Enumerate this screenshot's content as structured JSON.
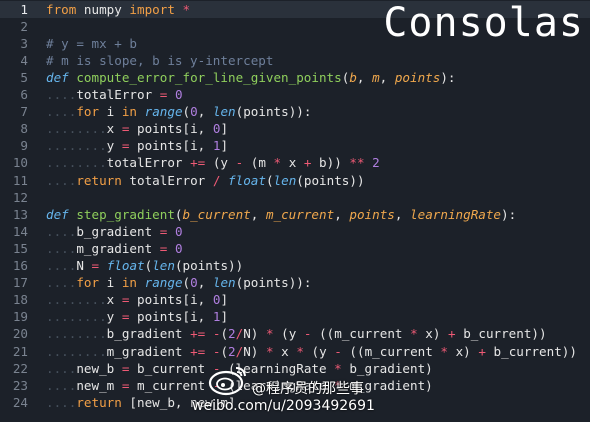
{
  "banner": {
    "font_name": "Consolas"
  },
  "editor": {
    "current_line": 1,
    "lines": [
      {
        "number": "1",
        "tokens": [
          {
            "t": "from",
            "c": "kw"
          },
          {
            "t": " numpy ",
            "c": "plain"
          },
          {
            "t": "import",
            "c": "kw"
          },
          {
            "t": " ",
            "c": "plain"
          },
          {
            "t": "*",
            "c": "op"
          }
        ]
      },
      {
        "number": "2",
        "tokens": []
      },
      {
        "number": "3",
        "tokens": [
          {
            "t": "# y = mx + b",
            "c": "cm"
          }
        ]
      },
      {
        "number": "4",
        "tokens": [
          {
            "t": "# m is slope, b is y-intercept",
            "c": "cm"
          }
        ]
      },
      {
        "number": "5",
        "tokens": [
          {
            "t": "def",
            "c": "def"
          },
          {
            "t": " ",
            "c": "plain"
          },
          {
            "t": "compute_error_for_line_given_points",
            "c": "fn"
          },
          {
            "t": "(",
            "c": "plain"
          },
          {
            "t": "b",
            "c": "param"
          },
          {
            "t": ", ",
            "c": "plain"
          },
          {
            "t": "m",
            "c": "param"
          },
          {
            "t": ", ",
            "c": "plain"
          },
          {
            "t": "points",
            "c": "param"
          },
          {
            "t": "):",
            "c": "plain"
          }
        ]
      },
      {
        "number": "6",
        "tokens": [
          {
            "t": "....",
            "c": "guide"
          },
          {
            "t": "totalError ",
            "c": "plain"
          },
          {
            "t": "=",
            "c": "op"
          },
          {
            "t": " ",
            "c": "plain"
          },
          {
            "t": "0",
            "c": "num"
          }
        ]
      },
      {
        "number": "7",
        "tokens": [
          {
            "t": "....",
            "c": "guide"
          },
          {
            "t": "for",
            "c": "kw"
          },
          {
            "t": " i ",
            "c": "plain"
          },
          {
            "t": "in",
            "c": "kw"
          },
          {
            "t": " ",
            "c": "plain"
          },
          {
            "t": "range",
            "c": "builtin"
          },
          {
            "t": "(",
            "c": "plain"
          },
          {
            "t": "0",
            "c": "num"
          },
          {
            "t": ", ",
            "c": "plain"
          },
          {
            "t": "len",
            "c": "builtin"
          },
          {
            "t": "(points)):",
            "c": "plain"
          }
        ]
      },
      {
        "number": "8",
        "tokens": [
          {
            "t": "........",
            "c": "guide"
          },
          {
            "t": "x ",
            "c": "plain"
          },
          {
            "t": "=",
            "c": "op"
          },
          {
            "t": " points[i, ",
            "c": "plain"
          },
          {
            "t": "0",
            "c": "num"
          },
          {
            "t": "]",
            "c": "plain"
          }
        ]
      },
      {
        "number": "9",
        "tokens": [
          {
            "t": "........",
            "c": "guide"
          },
          {
            "t": "y ",
            "c": "plain"
          },
          {
            "t": "=",
            "c": "op"
          },
          {
            "t": " points[i, ",
            "c": "plain"
          },
          {
            "t": "1",
            "c": "num"
          },
          {
            "t": "]",
            "c": "plain"
          }
        ]
      },
      {
        "number": "10",
        "tokens": [
          {
            "t": "........",
            "c": "guide"
          },
          {
            "t": "totalError ",
            "c": "plain"
          },
          {
            "t": "+=",
            "c": "op"
          },
          {
            "t": " (y ",
            "c": "plain"
          },
          {
            "t": "-",
            "c": "op"
          },
          {
            "t": " (m ",
            "c": "plain"
          },
          {
            "t": "*",
            "c": "op"
          },
          {
            "t": " x ",
            "c": "plain"
          },
          {
            "t": "+",
            "c": "op"
          },
          {
            "t": " b)) ",
            "c": "plain"
          },
          {
            "t": "**",
            "c": "op"
          },
          {
            "t": " ",
            "c": "plain"
          },
          {
            "t": "2",
            "c": "num"
          }
        ]
      },
      {
        "number": "11",
        "tokens": [
          {
            "t": "....",
            "c": "guide"
          },
          {
            "t": "return",
            "c": "kw"
          },
          {
            "t": " totalError ",
            "c": "plain"
          },
          {
            "t": "/",
            "c": "op"
          },
          {
            "t": " ",
            "c": "plain"
          },
          {
            "t": "float",
            "c": "builtin"
          },
          {
            "t": "(",
            "c": "plain"
          },
          {
            "t": "len",
            "c": "builtin"
          },
          {
            "t": "(points))",
            "c": "plain"
          }
        ]
      },
      {
        "number": "12",
        "tokens": []
      },
      {
        "number": "13",
        "tokens": [
          {
            "t": "def",
            "c": "def"
          },
          {
            "t": " ",
            "c": "plain"
          },
          {
            "t": "step_gradient",
            "c": "fn"
          },
          {
            "t": "(",
            "c": "plain"
          },
          {
            "t": "b_current",
            "c": "param"
          },
          {
            "t": ", ",
            "c": "plain"
          },
          {
            "t": "m_current",
            "c": "param"
          },
          {
            "t": ", ",
            "c": "plain"
          },
          {
            "t": "points",
            "c": "param"
          },
          {
            "t": ", ",
            "c": "plain"
          },
          {
            "t": "learningRate",
            "c": "param"
          },
          {
            "t": "):",
            "c": "plain"
          }
        ]
      },
      {
        "number": "14",
        "tokens": [
          {
            "t": "....",
            "c": "guide"
          },
          {
            "t": "b_gradient ",
            "c": "plain"
          },
          {
            "t": "=",
            "c": "op"
          },
          {
            "t": " ",
            "c": "plain"
          },
          {
            "t": "0",
            "c": "num"
          }
        ]
      },
      {
        "number": "15",
        "tokens": [
          {
            "t": "....",
            "c": "guide"
          },
          {
            "t": "m_gradient ",
            "c": "plain"
          },
          {
            "t": "=",
            "c": "op"
          },
          {
            "t": " ",
            "c": "plain"
          },
          {
            "t": "0",
            "c": "num"
          }
        ]
      },
      {
        "number": "16",
        "tokens": [
          {
            "t": "....",
            "c": "guide"
          },
          {
            "t": "N ",
            "c": "plain"
          },
          {
            "t": "=",
            "c": "op"
          },
          {
            "t": " ",
            "c": "plain"
          },
          {
            "t": "float",
            "c": "builtin"
          },
          {
            "t": "(",
            "c": "plain"
          },
          {
            "t": "len",
            "c": "builtin"
          },
          {
            "t": "(points))",
            "c": "plain"
          }
        ]
      },
      {
        "number": "17",
        "tokens": [
          {
            "t": "....",
            "c": "guide"
          },
          {
            "t": "for",
            "c": "kw"
          },
          {
            "t": " i ",
            "c": "plain"
          },
          {
            "t": "in",
            "c": "kw"
          },
          {
            "t": " ",
            "c": "plain"
          },
          {
            "t": "range",
            "c": "builtin"
          },
          {
            "t": "(",
            "c": "plain"
          },
          {
            "t": "0",
            "c": "num"
          },
          {
            "t": ", ",
            "c": "plain"
          },
          {
            "t": "len",
            "c": "builtin"
          },
          {
            "t": "(points)):",
            "c": "plain"
          }
        ]
      },
      {
        "number": "18",
        "tokens": [
          {
            "t": "........",
            "c": "guide"
          },
          {
            "t": "x ",
            "c": "plain"
          },
          {
            "t": "=",
            "c": "op"
          },
          {
            "t": " points[i, ",
            "c": "plain"
          },
          {
            "t": "0",
            "c": "num"
          },
          {
            "t": "]",
            "c": "plain"
          }
        ]
      },
      {
        "number": "19",
        "tokens": [
          {
            "t": "........",
            "c": "guide"
          },
          {
            "t": "y ",
            "c": "plain"
          },
          {
            "t": "=",
            "c": "op"
          },
          {
            "t": " points[i, ",
            "c": "plain"
          },
          {
            "t": "1",
            "c": "num"
          },
          {
            "t": "]",
            "c": "plain"
          }
        ]
      },
      {
        "number": "20",
        "tokens": [
          {
            "t": "........",
            "c": "guide"
          },
          {
            "t": "b_gradient ",
            "c": "plain"
          },
          {
            "t": "+=",
            "c": "op"
          },
          {
            "t": " ",
            "c": "plain"
          },
          {
            "t": "-",
            "c": "op"
          },
          {
            "t": "(",
            "c": "plain"
          },
          {
            "t": "2",
            "c": "num"
          },
          {
            "t": "/",
            "c": "op"
          },
          {
            "t": "N) ",
            "c": "plain"
          },
          {
            "t": "*",
            "c": "op"
          },
          {
            "t": " (y ",
            "c": "plain"
          },
          {
            "t": "-",
            "c": "op"
          },
          {
            "t": " ((m_current ",
            "c": "plain"
          },
          {
            "t": "*",
            "c": "op"
          },
          {
            "t": " x) ",
            "c": "plain"
          },
          {
            "t": "+",
            "c": "op"
          },
          {
            "t": " b_current))",
            "c": "plain"
          }
        ]
      },
      {
        "number": "21",
        "tokens": [
          {
            "t": "........",
            "c": "guide"
          },
          {
            "t": "m_gradient ",
            "c": "plain"
          },
          {
            "t": "+=",
            "c": "op"
          },
          {
            "t": " ",
            "c": "plain"
          },
          {
            "t": "-",
            "c": "op"
          },
          {
            "t": "(",
            "c": "plain"
          },
          {
            "t": "2",
            "c": "num"
          },
          {
            "t": "/",
            "c": "op"
          },
          {
            "t": "N) ",
            "c": "plain"
          },
          {
            "t": "*",
            "c": "op"
          },
          {
            "t": " x ",
            "c": "plain"
          },
          {
            "t": "*",
            "c": "op"
          },
          {
            "t": " (y ",
            "c": "plain"
          },
          {
            "t": "-",
            "c": "op"
          },
          {
            "t": " ((m_current ",
            "c": "plain"
          },
          {
            "t": "*",
            "c": "op"
          },
          {
            "t": " x) ",
            "c": "plain"
          },
          {
            "t": "+",
            "c": "op"
          },
          {
            "t": " b_current))",
            "c": "plain"
          }
        ]
      },
      {
        "number": "22",
        "tokens": [
          {
            "t": "....",
            "c": "guide"
          },
          {
            "t": "new_b ",
            "c": "plain"
          },
          {
            "t": "=",
            "c": "op"
          },
          {
            "t": " b_current ",
            "c": "plain"
          },
          {
            "t": "-",
            "c": "op"
          },
          {
            "t": " (learningRate ",
            "c": "plain"
          },
          {
            "t": "*",
            "c": "op"
          },
          {
            "t": " b_gradient)",
            "c": "plain"
          }
        ]
      },
      {
        "number": "23",
        "tokens": [
          {
            "t": "....",
            "c": "guide"
          },
          {
            "t": "new_m ",
            "c": "plain"
          },
          {
            "t": "=",
            "c": "op"
          },
          {
            "t": " m_current ",
            "c": "plain"
          },
          {
            "t": "-",
            "c": "op"
          },
          {
            "t": " (learningRate ",
            "c": "plain"
          },
          {
            "t": "*",
            "c": "op"
          },
          {
            "t": " m_gradient)",
            "c": "plain"
          }
        ]
      },
      {
        "number": "24",
        "tokens": [
          {
            "t": "....",
            "c": "guide"
          },
          {
            "t": "return",
            "c": "kw"
          },
          {
            "t": " [new_b, new_m]",
            "c": "plain"
          }
        ]
      }
    ]
  },
  "watermark": {
    "name": "@程序员的那些事",
    "url": "weibo.com/u/2093492691"
  },
  "colors": {
    "background": "#1c2129",
    "current_line": "#2a313b",
    "keyword": "#f19f46",
    "function": "#8fcf5c",
    "parameter": "#f0a84d",
    "number": "#b07fe0",
    "operator": "#ee5a75",
    "comment": "#6e7f9a",
    "builtin": "#66b5ec"
  }
}
